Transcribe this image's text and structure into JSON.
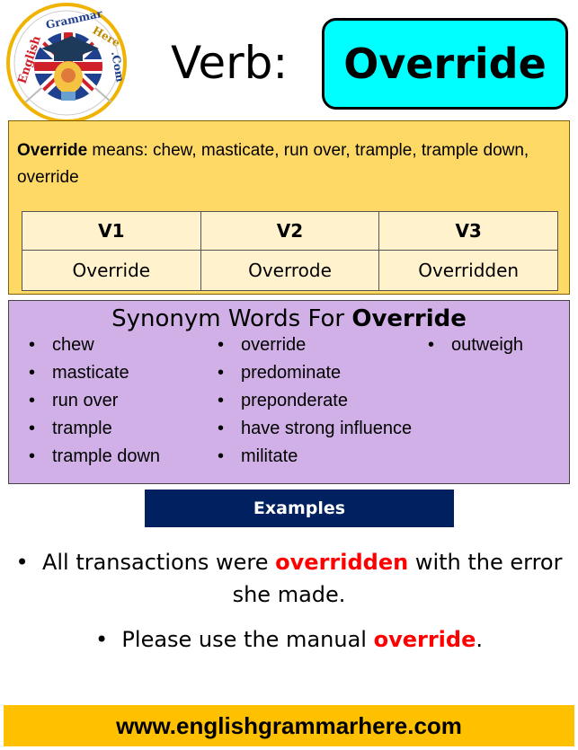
{
  "logo": {
    "text_parts": [
      "English",
      "Grammar",
      "Here",
      ".Com"
    ],
    "icon": "graduation-cap-lightbulb-uk-flag-logo"
  },
  "header": {
    "label": "Verb:",
    "word": "Override",
    "word_box_color": "#00ffff"
  },
  "meaning": {
    "word": "Override",
    "text": " means: chew, masticate, run over, trample, trample down, override",
    "panel_color": "#ffd966"
  },
  "forms_table": {
    "headers": [
      "V1",
      "V2",
      "V3"
    ],
    "values": [
      "Override",
      "Overrode",
      "Overridden"
    ]
  },
  "synonyms": {
    "title_prefix": "Synonym Words For ",
    "title_word": "Override",
    "panel_color": "#d0b0e6",
    "columns": [
      [
        "chew",
        "masticate",
        "run over",
        "trample",
        "trample down"
      ],
      [
        "override",
        "predominate",
        "preponderate",
        "have strong influence",
        "militate"
      ],
      [
        "outweigh"
      ]
    ]
  },
  "examples": {
    "header": "Examples",
    "header_color": "#002060",
    "highlight_color": "#ff0000",
    "items": [
      {
        "before": "All transactions were ",
        "highlight": "overridden",
        "after": " with the error she made."
      },
      {
        "before": "Please use the manual ",
        "highlight": "override",
        "after": "."
      }
    ]
  },
  "footer": {
    "url": "www.englishgrammarhere.com",
    "color": "#ffc000"
  }
}
